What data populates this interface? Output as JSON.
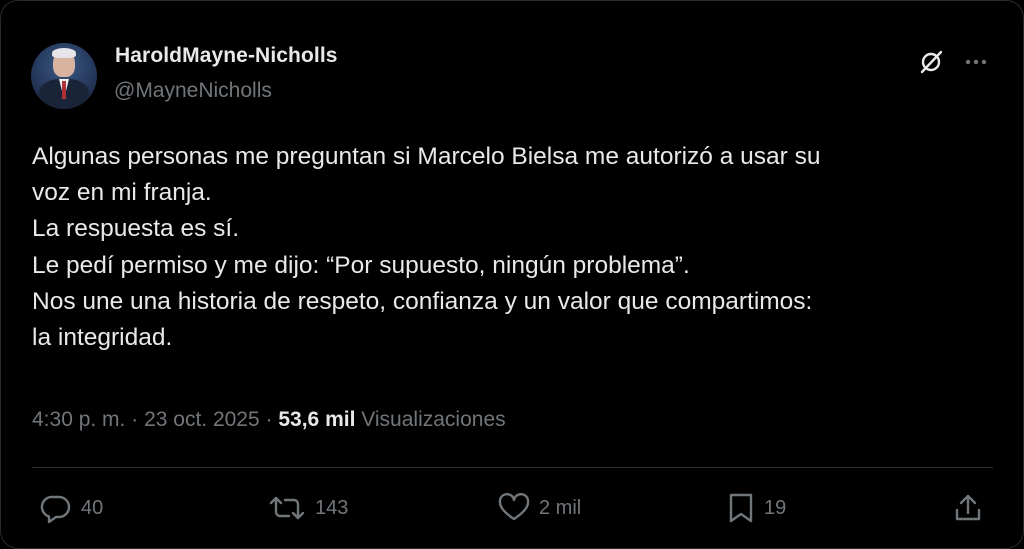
{
  "author": {
    "display_name": "HaroldMayne-Nicholls",
    "handle": "@MayneNicholls"
  },
  "tweet": {
    "lines": [
      "Algunas personas me preguntan si Marcelo Bielsa me autorizó a usar su",
      "voz en mi franja.",
      "La respuesta es sí.",
      "Le pedí permiso y me dijo: “Por supuesto, ningún problema”.",
      "Nos une una historia de respeto, confianza y un valor que compartimos:",
      "la integridad."
    ]
  },
  "meta": {
    "time": "4:30 p. m.",
    "separator": "·",
    "date": "23 oct. 2025",
    "views_count": "53,6 mil",
    "views_label": "Visualizaciones"
  },
  "actions": {
    "replies": "40",
    "reposts": "143",
    "likes": "2 mil",
    "bookmarks": "19"
  },
  "icons": {
    "header": [
      "grok-icon",
      "more-icon"
    ],
    "actions": [
      "reply-icon",
      "repost-icon",
      "like-icon",
      "bookmark-icon",
      "share-icon"
    ]
  },
  "colors": {
    "background": "#000000",
    "text_primary": "#e7e9ea",
    "text_secondary": "#71767b",
    "divider": "#2f3336"
  }
}
